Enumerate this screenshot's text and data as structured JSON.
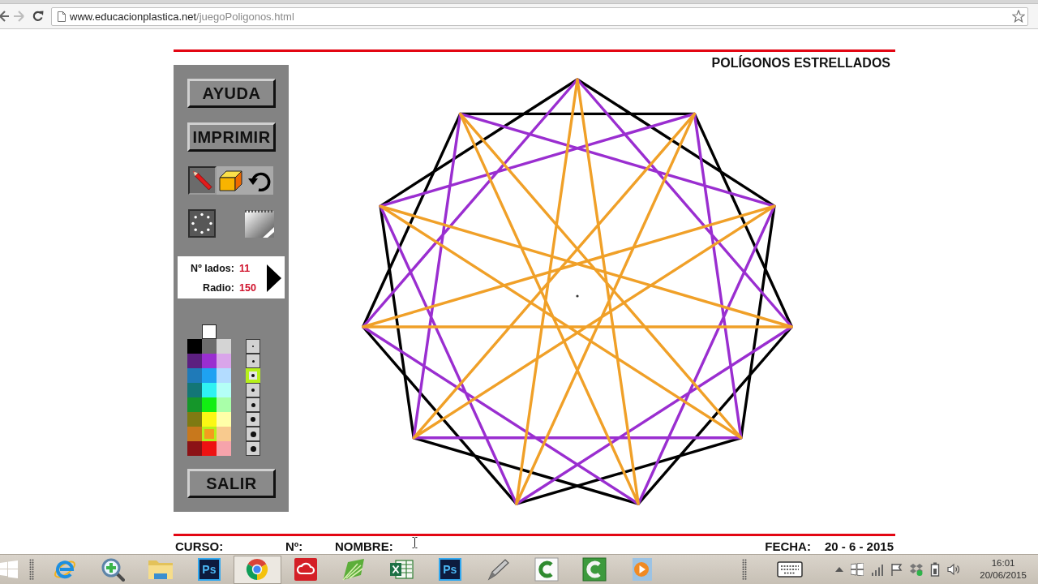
{
  "browser": {
    "url": {
      "domain": "www.educacionplastica.net",
      "path": "/juegoPoligonos.html"
    }
  },
  "page": {
    "title": "POLÍGONOS ESTRELLADOS"
  },
  "panel": {
    "buttons": [
      "AYUDA",
      "IMPRIMIR"
    ],
    "tools": [
      {
        "kind": "pencil",
        "selected": true
      },
      {
        "kind": "eraser",
        "selected": false
      },
      {
        "kind": "undo",
        "selected": false
      }
    ],
    "params": [
      {
        "label": "Nº lados:",
        "value": "11"
      },
      {
        "label": "Radio:",
        "value": "150"
      }
    ],
    "palette": [
      [
        {
          "color": "#ffffff",
          "selected": false
        }
      ],
      [
        {
          "color": "#000000",
          "selected": false
        },
        {
          "color": "#6c6c6c",
          "selected": false
        },
        {
          "color": "#d4d4d4",
          "selected": false
        }
      ],
      [
        {
          "color": "#5c1f80",
          "selected": false
        },
        {
          "color": "#9a2ed0",
          "selected": false
        },
        {
          "color": "#d9a5ea",
          "selected": false
        }
      ],
      [
        {
          "color": "#1f7ab8",
          "selected": false
        },
        {
          "color": "#1ea2f2",
          "selected": false
        },
        {
          "color": "#b3dcff",
          "selected": false
        }
      ],
      [
        {
          "color": "#137676",
          "selected": false
        },
        {
          "color": "#2ff2f2",
          "selected": false
        },
        {
          "color": "#b4fff6",
          "selected": false
        }
      ],
      [
        {
          "color": "#15962a",
          "selected": false
        },
        {
          "color": "#12ee12",
          "selected": false
        },
        {
          "color": "#a9ffa9",
          "selected": false
        }
      ],
      [
        {
          "color": "#7f7a12",
          "selected": false
        },
        {
          "color": "#fbf714",
          "selected": false
        },
        {
          "color": "#ffffa8",
          "selected": false
        }
      ],
      [
        {
          "color": "#c8781c",
          "selected": false
        },
        {
          "color": "#f39c1e",
          "selected": true
        },
        {
          "color": "#f8ca8e",
          "selected": false
        }
      ],
      [
        {
          "color": "#8c1216",
          "selected": false
        },
        {
          "color": "#ee1212",
          "selected": false
        },
        {
          "color": "#f6a3ab",
          "selected": false
        }
      ]
    ],
    "line_widths": [
      {
        "selected": false
      },
      {
        "selected": false
      },
      {
        "selected": true
      },
      {
        "selected": false
      },
      {
        "selected": false
      },
      {
        "selected": false
      },
      {
        "selected": false
      },
      {
        "selected": false
      }
    ],
    "exit_button": "SALIR"
  },
  "canvas": {
    "polygons": [
      {
        "kind": "second",
        "color": "#000000"
      },
      {
        "kind": "third",
        "color": "#9a2ed0"
      },
      {
        "kind": "fifth",
        "color": "#f0a028"
      }
    ]
  },
  "footer": {
    "fields": [
      "CURSO:",
      "Nº:",
      "NOMBRE:"
    ],
    "date_label": "FECHA:",
    "date": "20 - 6 - 2015"
  },
  "taskbar": {
    "apps": [
      {
        "kind": "ie",
        "selected": false
      },
      {
        "kind": "magnifier",
        "selected": false
      },
      {
        "kind": "folder",
        "selected": false
      },
      {
        "kind": "photoshop",
        "label": "Ps",
        "selected": false
      },
      {
        "kind": "chrome",
        "selected": true
      },
      {
        "kind": "cloud",
        "selected": false
      },
      {
        "kind": "corel",
        "selected": false
      },
      {
        "kind": "excel",
        "selected": false
      },
      {
        "kind": "photoshop",
        "label": "Ps",
        "selected": false
      },
      {
        "kind": "pen",
        "selected": false
      },
      {
        "kind": "camtasia",
        "selected": false
      },
      {
        "kind": "recorder",
        "selected": false
      },
      {
        "kind": "player",
        "selected": false
      }
    ],
    "clock": {
      "time": "16:01",
      "date": "20/06/2015"
    }
  }
}
